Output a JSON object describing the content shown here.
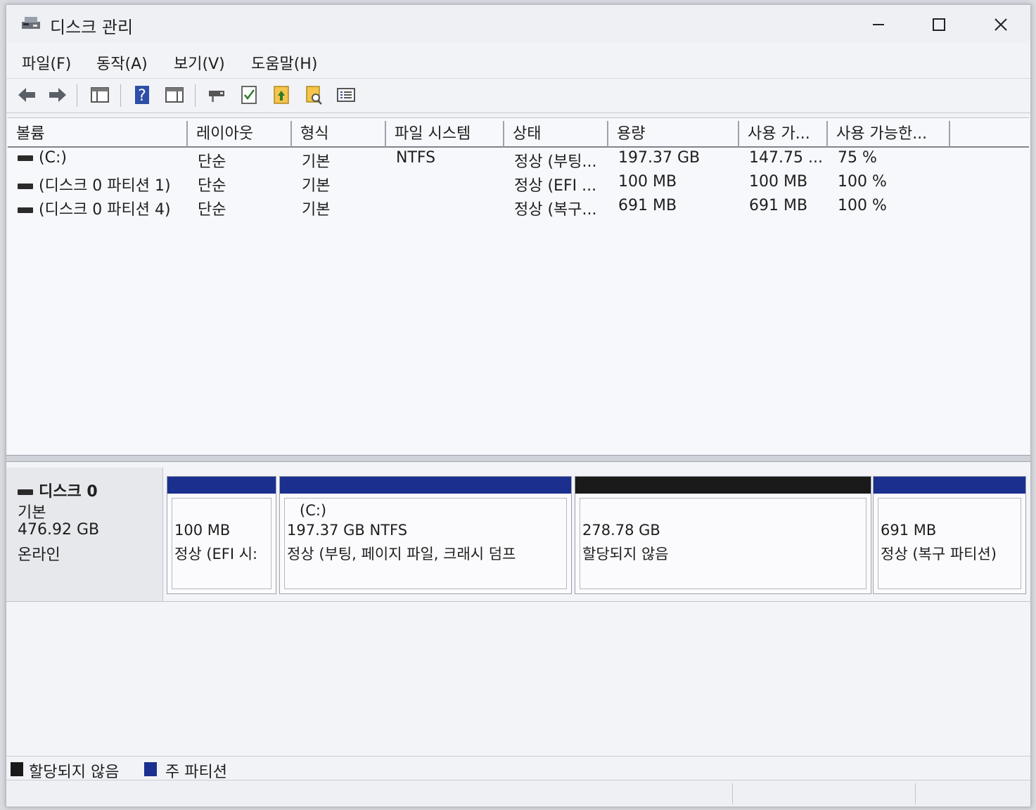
{
  "window": {
    "title": "디스크 관리",
    "icon": "disk-management-icon",
    "minimize_icon": "minimize-icon",
    "maximize_icon": "maximize-icon",
    "close_icon": "close-icon"
  },
  "menu": [
    "파일(F)",
    "동작(A)",
    "보기(V)",
    "도움말(H)"
  ],
  "toolbar": {
    "buttons": [
      "back-arrow-icon",
      "forward-arrow-icon",
      "console-tree-icon",
      "help-icon",
      "action-pane-icon",
      "connect-icon",
      "check-icon",
      "import-icon",
      "properties-icon",
      "list-icon"
    ]
  },
  "volumes": {
    "columns": [
      "볼륨",
      "레이아웃",
      "형식",
      "파일 시스템",
      "상태",
      "용량",
      "사용 가...",
      "사용 가능한..."
    ],
    "rows": [
      {
        "name": "(C:)",
        "layout": "단순",
        "type": "기본",
        "fs": "NTFS",
        "status": "정상 (부팅...",
        "capacity": "197.37 GB",
        "free": "147.75 ...",
        "pct": "75 %"
      },
      {
        "name": "(디스크 0 파티션 1)",
        "layout": "단순",
        "type": "기본",
        "fs": "",
        "status": "정상 (EFI ...",
        "capacity": "100 MB",
        "free": "100 MB",
        "pct": "100 %"
      },
      {
        "name": "(디스크 0 파티션 4)",
        "layout": "단순",
        "type": "기본",
        "fs": "",
        "status": "정상 (복구...",
        "capacity": "691 MB",
        "free": "691 MB",
        "pct": "100 %"
      }
    ]
  },
  "disk": {
    "name": "디스크 0",
    "type": "기본",
    "size": "476.92 GB",
    "state": "온라인",
    "partitions": [
      {
        "label": "",
        "size": "100 MB",
        "status": "정상 (EFI 시:",
        "kind": "primary"
      },
      {
        "label": "(C:)",
        "size": "197.37 GB NTFS",
        "status": "정상 (부팅, 페이지 파일, 크래시 덤프",
        "kind": "primary"
      },
      {
        "label": "",
        "size": "278.78 GB",
        "status": "할당되지 않음",
        "kind": "unallocated"
      },
      {
        "label": "",
        "size": "691 MB",
        "status": "정상 (복구 파티션)",
        "kind": "primary"
      }
    ]
  },
  "legend": [
    {
      "label": "할당되지 않음",
      "color": "#1a1a1a"
    },
    {
      "label": "주 파티션",
      "color": "#1b2f8f"
    }
  ],
  "colors": {
    "primary": "#1b2f8f",
    "unallocated": "#1a1a1a"
  }
}
